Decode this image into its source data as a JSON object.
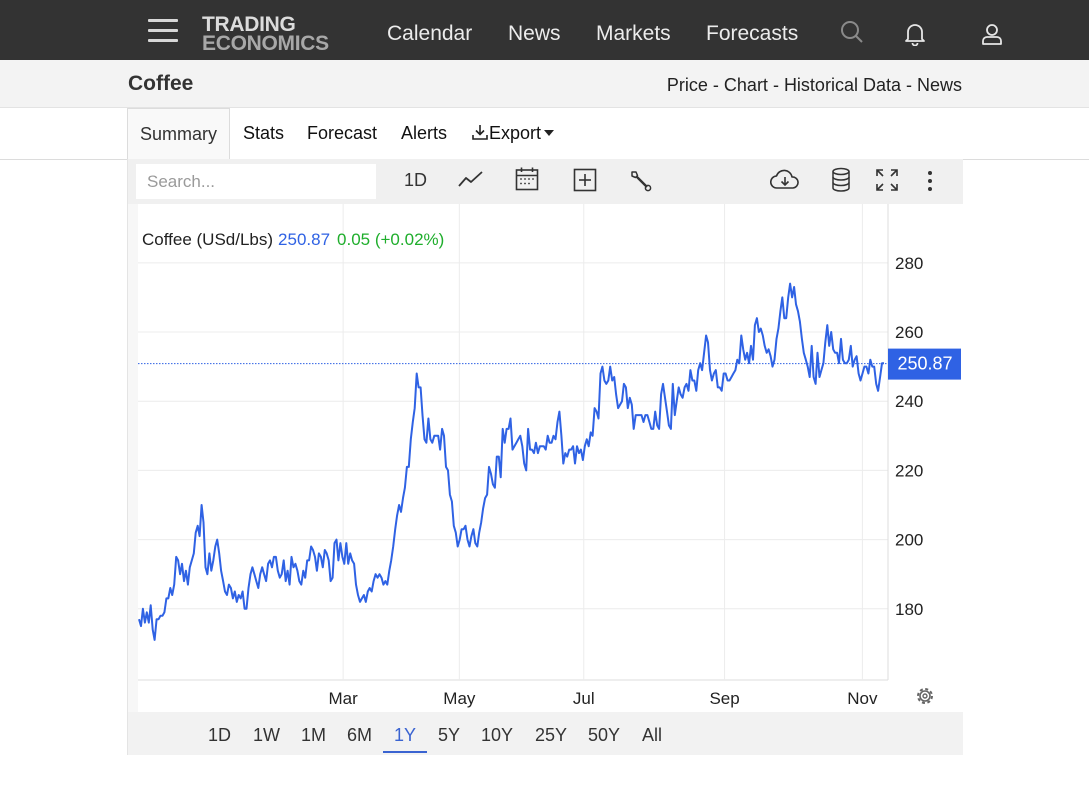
{
  "nav": {
    "logo_line1": "TRADING",
    "logo_line2": "ECONOMICS",
    "links": [
      "Calendar",
      "News",
      "Markets",
      "Forecasts"
    ],
    "icons": [
      "menu-icon",
      "search-icon",
      "bell-icon",
      "user-icon"
    ]
  },
  "header": {
    "title": "Coffee",
    "links": [
      "Price",
      "Chart",
      "Historical Data",
      "News"
    ],
    "separator": "-"
  },
  "tabs": [
    {
      "label": "Summary",
      "active": true
    },
    {
      "label": "Stats",
      "active": false
    },
    {
      "label": "Forecast",
      "active": false
    },
    {
      "label": "Alerts",
      "active": false
    },
    {
      "label": "Export",
      "active": false
    }
  ],
  "toolbar": {
    "search_placeholder": "Search...",
    "interval": "1D",
    "icons": [
      "line-chart-icon",
      "calendar-icon",
      "add-compare-icon",
      "wrench-icon",
      "cloud-download-icon",
      "database-icon",
      "fullscreen-icon",
      "more-vertical-icon"
    ]
  },
  "quote": {
    "name": "Coffee (USd/Lbs)",
    "price": "250.87",
    "change": "0.05 (+0.02%)",
    "price_color": "#2f62e4",
    "change_color": "#1fae2c"
  },
  "range_buttons": [
    "1D",
    "1W",
    "1M",
    "6M",
    "1Y",
    "5Y",
    "10Y",
    "25Y",
    "50Y",
    "All"
  ],
  "range_selected": "1Y",
  "colors": {
    "series": "#2f62e4",
    "nav_background": "#333333",
    "selected_range": "#3a63d1"
  },
  "chart_data": {
    "type": "line",
    "title": "",
    "xlabel": "",
    "ylabel": "",
    "ylim": [
      160,
      297
    ],
    "y_ticks": [
      180,
      200,
      220,
      240,
      260,
      280
    ],
    "x_ticks": [
      "Mar",
      "May",
      "Jul",
      "Sep",
      "Nov"
    ],
    "last_value_label": "250.87",
    "grid": true,
    "series": [
      {
        "name": "Coffee (USd/Lbs)",
        "values": [
          177,
          175,
          180,
          176,
          179,
          176,
          181,
          174,
          171,
          177,
          177,
          178,
          178,
          179,
          183,
          183,
          186,
          184,
          187,
          195,
          194,
          190,
          193,
          188,
          191,
          187,
          192,
          194,
          196,
          202,
          204,
          201,
          210,
          205,
          192,
          190,
          196,
          191,
          194,
          198,
          200,
          196,
          191,
          188,
          185,
          184,
          187,
          186,
          183,
          185,
          182,
          184,
          183,
          185,
          180,
          180,
          186,
          190,
          192,
          190,
          188,
          186,
          190,
          192,
          190,
          188,
          193,
          194,
          192,
          195,
          195,
          191,
          189,
          190,
          194,
          188,
          191,
          187,
          195,
          192,
          193,
          191,
          188,
          187,
          191,
          189,
          194,
          194,
          198,
          197,
          195,
          191,
          196,
          195,
          192,
          197,
          196,
          194,
          188,
          189,
          199,
          200,
          194,
          199,
          195,
          193,
          199,
          193,
          196,
          194,
          193,
          187,
          184,
          182,
          183,
          184,
          182,
          185,
          186,
          185,
          188,
          190,
          189,
          190,
          189,
          187,
          188,
          187,
          191,
          194,
          198,
          203,
          207,
          210,
          208,
          212,
          215,
          221,
          221,
          229,
          234,
          238,
          248,
          244,
          244,
          236,
          229,
          228,
          235,
          229,
          228,
          230,
          230,
          230,
          226,
          232,
          230,
          221,
          220,
          213,
          211,
          204,
          202,
          198,
          200,
          203,
          203,
          204,
          200,
          198,
          201,
          203,
          199,
          198,
          202,
          205,
          209,
          212,
          213,
          221,
          219,
          216,
          215,
          224,
          224,
          218,
          232,
          228,
          232,
          232,
          235,
          226,
          227,
          228,
          229,
          230,
          227,
          222,
          220,
          232,
          226,
          226,
          225,
          228,
          225,
          227,
          227,
          227,
          226,
          230,
          228,
          228,
          230,
          229,
          234,
          237,
          230,
          222,
          225,
          224,
          226,
          226,
          227,
          222,
          227,
          225,
          226,
          223,
          227,
          229,
          227,
          231,
          230,
          238,
          237,
          235,
          248,
          250,
          246,
          245,
          246,
          250,
          246,
          247,
          242,
          238,
          239,
          240,
          245,
          244,
          238,
          241,
          239,
          232,
          236,
          236,
          236,
          236,
          234,
          236,
          236,
          234,
          232,
          232,
          237,
          233,
          232,
          242,
          245,
          241,
          237,
          233,
          232,
          245,
          236,
          240,
          244,
          242,
          241,
          244,
          245,
          243,
          249,
          246,
          246,
          243,
          249,
          251,
          249,
          254,
          259,
          257,
          249,
          246,
          248,
          249,
          244,
          244,
          243,
          248,
          248,
          246,
          246,
          247,
          248,
          249,
          252,
          251,
          259,
          255,
          252,
          254,
          251,
          256,
          252,
          262,
          264,
          260,
          261,
          259,
          256,
          254,
          255,
          253,
          250,
          252,
          258,
          261,
          266,
          270,
          264,
          264,
          270,
          274,
          270,
          273,
          268,
          266,
          263,
          258,
          254,
          252,
          250,
          247,
          256,
          247,
          245,
          254,
          247,
          249,
          251,
          257,
          262,
          256,
          260,
          255,
          254,
          254,
          251,
          258,
          252,
          251,
          251,
          252,
          256,
          250,
          252,
          253,
          248,
          246,
          248,
          250,
          250,
          248,
          252,
          250,
          250,
          245,
          243,
          247,
          251,
          251
        ]
      }
    ]
  }
}
